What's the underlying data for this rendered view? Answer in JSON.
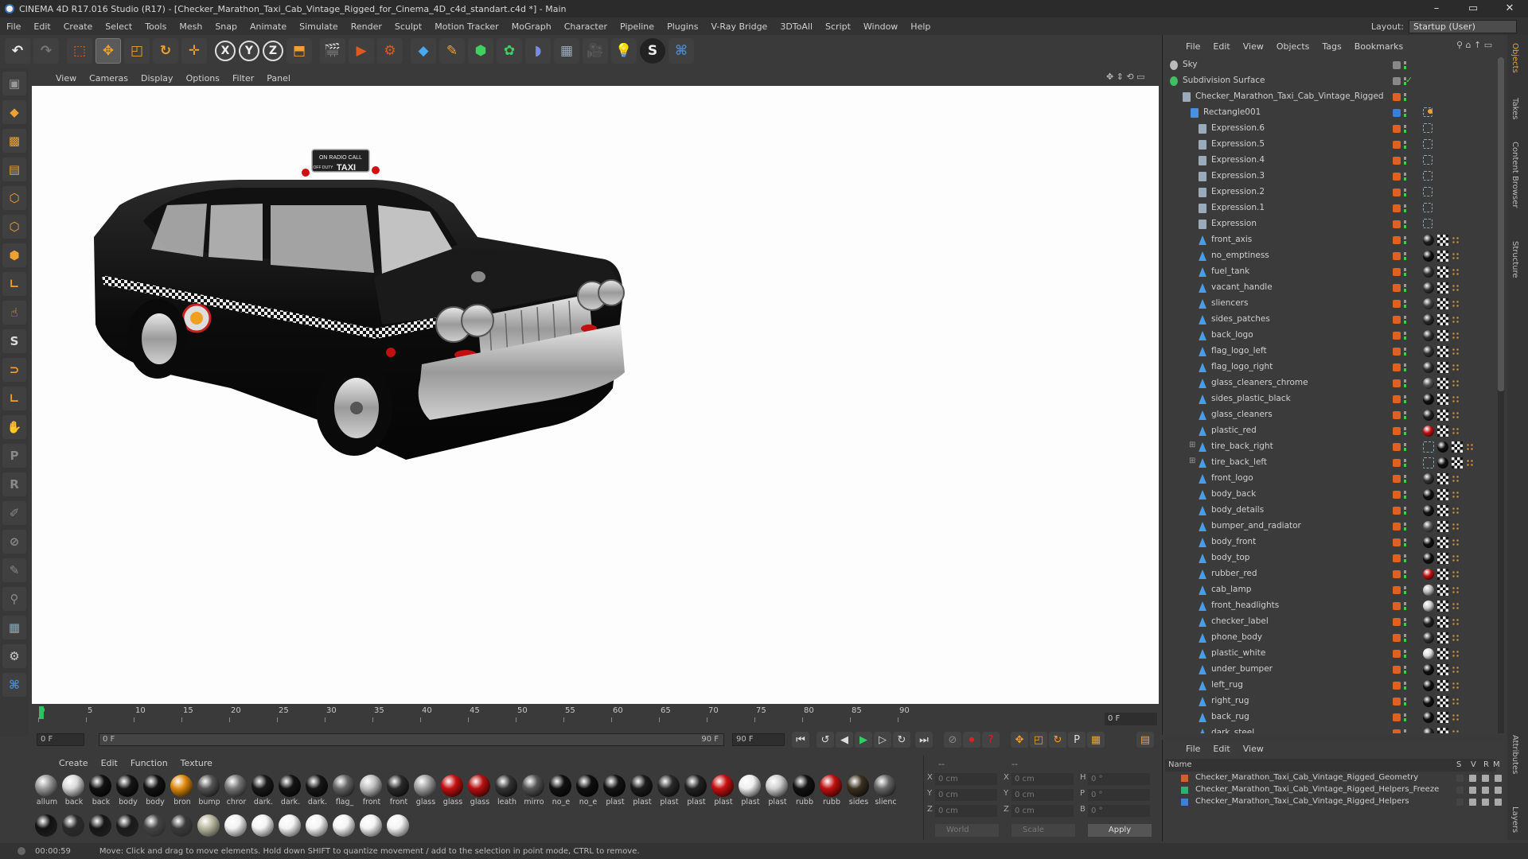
{
  "window": {
    "title": "CINEMA 4D R17.016 Studio (R17) - [Checker_Marathon_Taxi_Cab_Vintage_Rigged_for_Cinema_4D_c4d_standart.c4d *] - Main",
    "minimize": "–",
    "maximize": "▭",
    "close": "✕"
  },
  "menubar": [
    "File",
    "Edit",
    "Create",
    "Select",
    "Tools",
    "Mesh",
    "Snap",
    "Animate",
    "Simulate",
    "Render",
    "Sculpt",
    "Motion Tracker",
    "MoGraph",
    "Character",
    "Pipeline",
    "Plugins",
    "V-Ray Bridge",
    "3DToAll",
    "Script",
    "Window",
    "Help"
  ],
  "layout": {
    "label": "Layout:",
    "value": "Startup (User)"
  },
  "toolbar": [
    "undo",
    "redo",
    "live-select",
    "move",
    "scale",
    "rotate",
    "transform",
    "X",
    "Y",
    "Z",
    "coord-system",
    "render-view",
    "render-picture-viewer",
    "render-settings",
    "cube",
    "pen",
    "subdivision",
    "cloner",
    "deformer",
    "floor",
    "camera",
    "light",
    "sketch",
    "python"
  ],
  "viewport_menu": [
    "View",
    "Cameras",
    "Display",
    "Options",
    "Filter",
    "Panel"
  ],
  "timeline": {
    "ticks": [
      "0",
      "5",
      "10",
      "15",
      "20",
      "25",
      "30",
      "35",
      "40",
      "45",
      "50",
      "55",
      "60",
      "65",
      "70",
      "75",
      "80",
      "85",
      "90"
    ],
    "frame": "0 F"
  },
  "transport": {
    "start": "0 F",
    "range_start": "0 F",
    "range_end": "90 F",
    "end": "90 F"
  },
  "materials_menu": [
    "Create",
    "Edit",
    "Function",
    "Texture"
  ],
  "materials": [
    {
      "name": "allum",
      "color": "#9a9a9a"
    },
    {
      "name": "back",
      "color": "#d8d8d8"
    },
    {
      "name": "back",
      "color": "#111111"
    },
    {
      "name": "body",
      "color": "#151515"
    },
    {
      "name": "body",
      "color": "#121212"
    },
    {
      "name": "bron",
      "color": "#e08a10"
    },
    {
      "name": "bump",
      "color": "#555555"
    },
    {
      "name": "chror",
      "color": "#777777"
    },
    {
      "name": "dark.",
      "color": "#1a1a1a"
    },
    {
      "name": "dark.",
      "color": "#141414"
    },
    {
      "name": "dark.",
      "color": "#161616"
    },
    {
      "name": "flag_",
      "color": "#666666"
    },
    {
      "name": "front",
      "color": "#c0c0c0"
    },
    {
      "name": "front",
      "color": "#2a2a2a"
    },
    {
      "name": "glass",
      "color": "#a0a0a0"
    },
    {
      "name": "glass",
      "color": "#c41010"
    },
    {
      "name": "glass",
      "color": "#b81010"
    },
    {
      "name": "leath",
      "color": "#333333"
    },
    {
      "name": "mirro",
      "color": "#555555"
    },
    {
      "name": "no_e",
      "color": "#111111"
    },
    {
      "name": "no_e",
      "color": "#0f0f0f"
    },
    {
      "name": "plast",
      "color": "#131313"
    },
    {
      "name": "plast",
      "color": "#1c1c1c"
    },
    {
      "name": "plast",
      "color": "#2a2a2a"
    },
    {
      "name": "plast",
      "color": "#222222"
    },
    {
      "name": "plast",
      "color": "#c81010"
    },
    {
      "name": "plast",
      "color": "#eeeeee"
    },
    {
      "name": "plast",
      "color": "#d0d0d0"
    },
    {
      "name": "rubb",
      "color": "#121212"
    },
    {
      "name": "rubb",
      "color": "#c01010"
    },
    {
      "name": "sides",
      "color": "#3a3020"
    },
    {
      "name": "slienc",
      "color": "#666666"
    }
  ],
  "materials_row2": [
    "#111111",
    "#2a2a2a",
    "#151515",
    "#1a1a1a",
    "#444444",
    "#3a3a3a",
    "#b8b8a0",
    "#f2f2f2",
    "#f4f4f4",
    "#f4f4f4",
    "#f4f4f4",
    "#f4f4f4",
    "#f4f4f4",
    "#f4f4f4"
  ],
  "coords": {
    "header_left": "--",
    "header_mid": "--",
    "rows": [
      {
        "a": "X",
        "av": "0 cm",
        "b": "X",
        "bv": "0 cm",
        "c": "H",
        "cv": "0 °"
      },
      {
        "a": "Y",
        "av": "0 cm",
        "b": "Y",
        "bv": "0 cm",
        "c": "P",
        "cv": "0 °"
      },
      {
        "a": "Z",
        "av": "0 cm",
        "b": "Z",
        "bv": "0 cm",
        "c": "B",
        "cv": "0 °"
      }
    ],
    "mode": "World",
    "scale": "Scale",
    "apply": "Apply"
  },
  "status": {
    "time": "00:00:59",
    "message": "Move: Click and drag to move elements. Hold down SHIFT to quantize movement / add to the selection in point mode, CTRL to remove."
  },
  "objects_menu": [
    "File",
    "Edit",
    "View",
    "Objects",
    "Tags",
    "Bookmarks"
  ],
  "objects": [
    {
      "name": "Sky",
      "indent": 0,
      "icon": "sky",
      "color": "#888888",
      "tags": "none"
    },
    {
      "name": "Subdivision Surface",
      "indent": 0,
      "icon": "subdiv",
      "color": "#888888",
      "tags": "check"
    },
    {
      "name": "Checker_Marathon_Taxi_Cab_Vintage_Rigged",
      "indent": 1,
      "icon": "null",
      "color": "#e06020",
      "tags": "none"
    },
    {
      "name": "Rectangle001",
      "indent": 2,
      "icon": "spline",
      "color": "#3a7ed8",
      "tags": "xpresso"
    },
    {
      "name": "Expression.6",
      "indent": 3,
      "icon": "null",
      "color": "#e06020",
      "tags": "exp"
    },
    {
      "name": "Expression.5",
      "indent": 3,
      "icon": "null",
      "color": "#e06020",
      "tags": "exp"
    },
    {
      "name": "Expression.4",
      "indent": 3,
      "icon": "null",
      "color": "#e06020",
      "tags": "exp"
    },
    {
      "name": "Expression.3",
      "indent": 3,
      "icon": "null",
      "color": "#e06020",
      "tags": "exp"
    },
    {
      "name": "Expression.2",
      "indent": 3,
      "icon": "null",
      "color": "#e06020",
      "tags": "exp"
    },
    {
      "name": "Expression.1",
      "indent": 3,
      "icon": "null",
      "color": "#e06020",
      "tags": "exp"
    },
    {
      "name": "Expression",
      "indent": 3,
      "icon": "null",
      "color": "#e06020",
      "tags": "exp"
    },
    {
      "name": "front_axis",
      "indent": 3,
      "icon": "poly",
      "color": "#e06020",
      "tags": "mat",
      "mat": "#222222"
    },
    {
      "name": "no_emptiness",
      "indent": 3,
      "icon": "poly",
      "color": "#e06020",
      "tags": "mat",
      "mat": "#111111"
    },
    {
      "name": "fuel_tank",
      "indent": 3,
      "icon": "poly",
      "color": "#e06020",
      "tags": "mat",
      "mat": "#333333"
    },
    {
      "name": "vacant_handle",
      "indent": 3,
      "icon": "poly",
      "color": "#e06020",
      "tags": "mat",
      "mat": "#333333"
    },
    {
      "name": "sliencers",
      "indent": 3,
      "icon": "poly",
      "color": "#e06020",
      "tags": "mat",
      "mat": "#444444"
    },
    {
      "name": "sides_patches",
      "indent": 3,
      "icon": "poly",
      "color": "#e06020",
      "tags": "mat",
      "mat": "#2a2a2a"
    },
    {
      "name": "back_logo",
      "indent": 3,
      "icon": "poly",
      "color": "#e06020",
      "tags": "mat",
      "mat": "#333333"
    },
    {
      "name": "flag_logo_left",
      "indent": 3,
      "icon": "poly",
      "color": "#e06020",
      "tags": "mat",
      "mat": "#333333"
    },
    {
      "name": "flag_logo_right",
      "indent": 3,
      "icon": "poly",
      "color": "#e06020",
      "tags": "mat",
      "mat": "#333333"
    },
    {
      "name": "glass_cleaners_chrome",
      "indent": 3,
      "icon": "poly",
      "color": "#e06020",
      "tags": "mat",
      "mat": "#555555"
    },
    {
      "name": "sides_plastic_black",
      "indent": 3,
      "icon": "poly",
      "color": "#e06020",
      "tags": "mat",
      "mat": "#111111"
    },
    {
      "name": "glass_cleaners",
      "indent": 3,
      "icon": "poly",
      "color": "#e06020",
      "tags": "mat",
      "mat": "#222222"
    },
    {
      "name": "plastic_red",
      "indent": 3,
      "icon": "poly",
      "color": "#e06020",
      "tags": "mat",
      "mat": "#c01010"
    },
    {
      "name": "tire_back_right",
      "indent": 3,
      "icon": "poly",
      "color": "#e06020",
      "tags": "mat2",
      "mat": "#111111",
      "expand": true
    },
    {
      "name": "tire_back_left",
      "indent": 3,
      "icon": "poly",
      "color": "#e06020",
      "tags": "mat2",
      "mat": "#111111",
      "expand": true
    },
    {
      "name": "front_logo",
      "indent": 3,
      "icon": "poly",
      "color": "#e06020",
      "tags": "mat",
      "mat": "#333333"
    },
    {
      "name": "body_back",
      "indent": 3,
      "icon": "poly",
      "color": "#e06020",
      "tags": "mat",
      "mat": "#111111"
    },
    {
      "name": "body_details",
      "indent": 3,
      "icon": "poly",
      "color": "#e06020",
      "tags": "mat",
      "mat": "#151515"
    },
    {
      "name": "bumper_and_radiator",
      "indent": 3,
      "icon": "poly",
      "color": "#e06020",
      "tags": "mat",
      "mat": "#555555"
    },
    {
      "name": "body_front",
      "indent": 3,
      "icon": "poly",
      "color": "#e06020",
      "tags": "mat",
      "mat": "#111111"
    },
    {
      "name": "body_top",
      "indent": 3,
      "icon": "poly",
      "color": "#e06020",
      "tags": "mat",
      "mat": "#111111"
    },
    {
      "name": "rubber_red",
      "indent": 3,
      "icon": "poly",
      "color": "#e06020",
      "tags": "mat",
      "mat": "#c01010"
    },
    {
      "name": "cab_lamp",
      "indent": 3,
      "icon": "poly",
      "color": "#e06020",
      "tags": "mat",
      "mat": "#bbbbbb"
    },
    {
      "name": "front_headlights",
      "indent": 3,
      "icon": "poly",
      "color": "#e06020",
      "tags": "mat",
      "mat": "#cccccc"
    },
    {
      "name": "checker_label",
      "indent": 3,
      "icon": "poly",
      "color": "#e06020",
      "tags": "mat",
      "mat": "#222222"
    },
    {
      "name": "phone_body",
      "indent": 3,
      "icon": "poly",
      "color": "#e06020",
      "tags": "mat",
      "mat": "#333333"
    },
    {
      "name": "plastic_white",
      "indent": 3,
      "icon": "poly",
      "color": "#e06020",
      "tags": "mat",
      "mat": "#dddddd"
    },
    {
      "name": "under_bumper",
      "indent": 3,
      "icon": "poly",
      "color": "#e06020",
      "tags": "mat",
      "mat": "#111111"
    },
    {
      "name": "left_rug",
      "indent": 3,
      "icon": "poly",
      "color": "#e06020",
      "tags": "mat",
      "mat": "#111111"
    },
    {
      "name": "right_rug",
      "indent": 3,
      "icon": "poly",
      "color": "#e06020",
      "tags": "mat",
      "mat": "#111111"
    },
    {
      "name": "back_rug",
      "indent": 3,
      "icon": "poly",
      "color": "#e06020",
      "tags": "mat",
      "mat": "#111111"
    },
    {
      "name": "dark_steel",
      "indent": 3,
      "icon": "poly",
      "color": "#e06020",
      "tags": "mat",
      "mat": "#222222"
    }
  ],
  "layers_menu": [
    "File",
    "Edit",
    "View"
  ],
  "layers_header": {
    "name": "Name",
    "s": "S",
    "v": "V",
    "r": "R",
    "m": "M"
  },
  "layers": [
    {
      "name": "Checker_Marathon_Taxi_Cab_Vintage_Rigged_Geometry",
      "color": "#d06030"
    },
    {
      "name": "Checker_Marathon_Taxi_Cab_Vintage_Rigged_Helpers_Freeze",
      "color": "#30b070"
    },
    {
      "name": "Checker_Marathon_Taxi_Cab_Vintage_Rigged_Helpers",
      "color": "#4080d0"
    }
  ],
  "side_tabs": [
    "Objects",
    "Takes",
    "Content Browser",
    "Structure",
    "Attributes",
    "Layers"
  ],
  "taxi_sign": {
    "line1": "ON RADIO CALL",
    "line2": "TAXI",
    "small": "OFF DUTY"
  }
}
